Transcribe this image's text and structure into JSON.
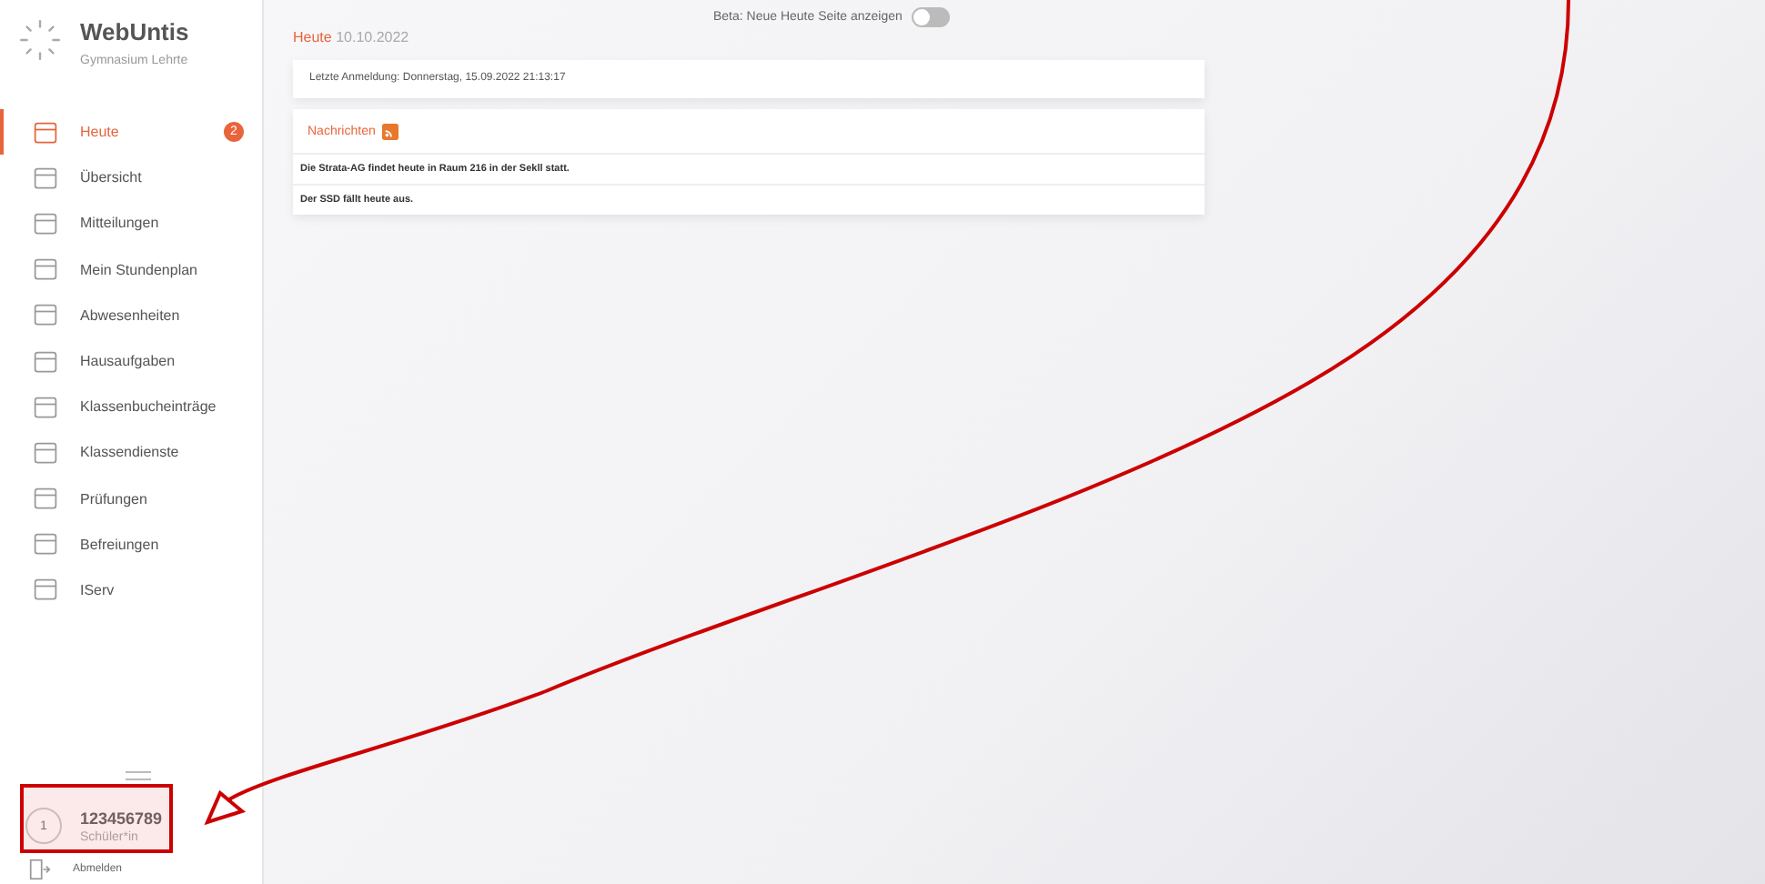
{
  "brand": {
    "name": "WebUntis",
    "school": "Gymnasium Lehrte"
  },
  "nav": [
    {
      "label": "Heute",
      "selected": true,
      "badge": "2"
    },
    {
      "label": "Übersicht",
      "selected": false
    },
    {
      "label": "Mitteilungen",
      "selected": false
    },
    {
      "label": "Mein Stundenplan",
      "selected": false
    },
    {
      "label": "Abwesenheiten",
      "selected": false
    },
    {
      "label": "Hausaufgaben",
      "selected": false
    },
    {
      "label": "Klassenbucheinträge",
      "selected": false
    },
    {
      "label": "Klassendienste",
      "selected": false
    },
    {
      "label": "Prüfungen",
      "selected": false
    },
    {
      "label": "Befreiungen",
      "selected": false
    },
    {
      "label": "IServ",
      "selected": false
    }
  ],
  "profile": {
    "avatar": "1",
    "id": "123456789",
    "role": "Schüler*in",
    "logout": "Abmelden"
  },
  "beta_toggle": {
    "label": "Beta: Neue Heute Seite anzeigen",
    "on": false
  },
  "page": {
    "title": "Heute",
    "date": "10.10.2022"
  },
  "last_login": "Letzte Anmeldung: Donnerstag, 15.09.2022 21:13:17",
  "messages": {
    "title": "Nachrichten",
    "items": [
      "Die Strata-AG findet heute in Raum 216 in der Sekll statt.",
      "Der SSD fällt heute aus."
    ]
  }
}
